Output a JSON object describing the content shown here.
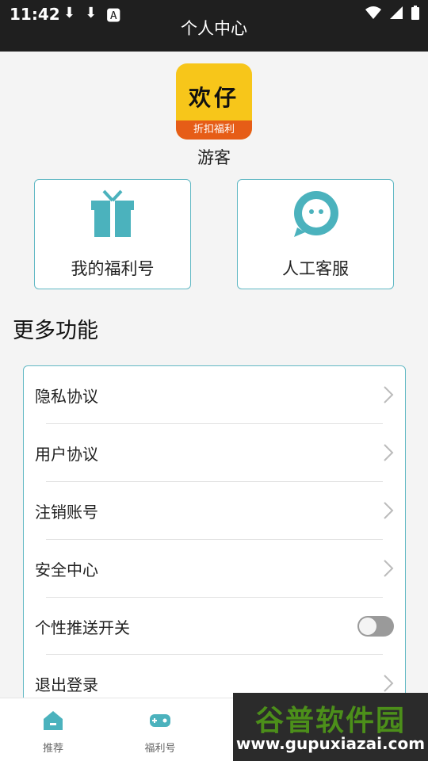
{
  "status": {
    "time": "11:42"
  },
  "header": {
    "title": "个人中心"
  },
  "profile": {
    "logo_text": "欢仔",
    "logo_band": "折扣福利",
    "username": "游客"
  },
  "cards": [
    {
      "label": "我的福利号",
      "icon": "gift-icon"
    },
    {
      "label": "人工客服",
      "icon": "chat-bubble-icon"
    }
  ],
  "section": {
    "title": "更多功能"
  },
  "menu": [
    {
      "label": "隐私协议"
    },
    {
      "label": "用户协议"
    },
    {
      "label": "注销账号"
    },
    {
      "label": "安全中心"
    },
    {
      "label": "个性推送开关",
      "toggle": false
    },
    {
      "label": "退出登录"
    }
  ],
  "tabs": [
    {
      "label": "推荐",
      "icon": "home-icon"
    },
    {
      "label": "福利号",
      "icon": "gamepad-icon"
    }
  ],
  "watermark": {
    "top": "谷普软件园",
    "bottom": "www.gupuxiazai.com"
  },
  "colors": {
    "accent": "#4bb2bd",
    "statusbar": "#1f1f1f"
  }
}
